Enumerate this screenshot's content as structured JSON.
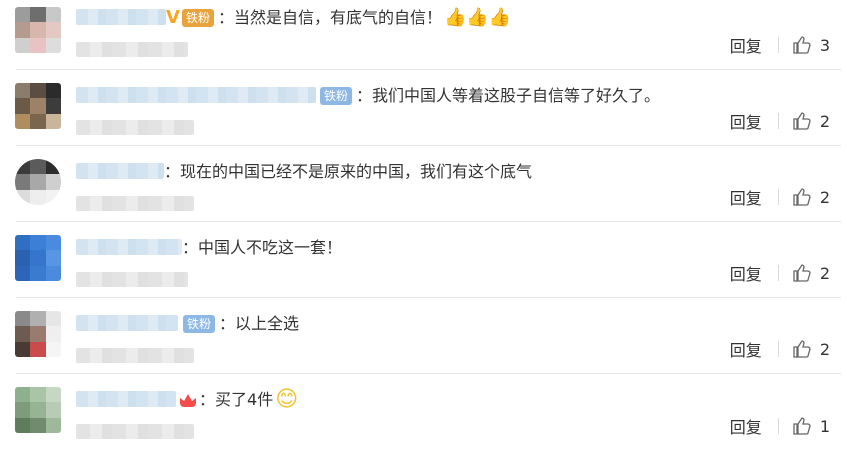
{
  "comments": [
    {
      "badges": [
        "vip",
        "gold-fan"
      ],
      "fan_label": "铁粉",
      "colon": "：",
      "text": "当然是自信，有底气的自信！",
      "emoji": "👍👍👍",
      "reply": "回复",
      "likes": "3"
    },
    {
      "fan_label": "铁粉",
      "colon": "：",
      "text": "我们中国人等着这股子自信等了好久了。",
      "reply": "回复",
      "likes": "2"
    },
    {
      "colon": "：",
      "text": "现在的中国已经不是原来的中国，我们有这个底气",
      "reply": "回复",
      "likes": "2"
    },
    {
      "colon": "：",
      "text": "中国人不吃这一套！",
      "reply": "回复",
      "likes": "2"
    },
    {
      "fan_label": "铁粉",
      "colon": "：",
      "text": "以上全选",
      "reply": "回复",
      "likes": "2"
    },
    {
      "colon": "：",
      "text": "买了4件",
      "emoji": "😊",
      "reply": "回复",
      "likes": "1"
    }
  ],
  "colors": {
    "fan_badge_blue": "#8db8e4",
    "fan_badge_gold": "#e8a33c",
    "vip": "#f5a623",
    "divider": "#e6e6e6"
  }
}
